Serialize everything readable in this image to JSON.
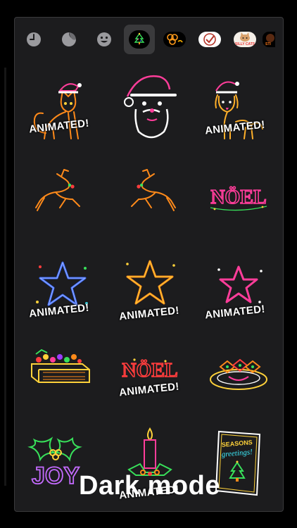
{
  "tabs": [
    {
      "name": "recents",
      "icon": "clock-icon"
    },
    {
      "name": "stickers-peel",
      "icon": "peel-sticker-icon"
    },
    {
      "name": "emoji",
      "icon": "smiley-icon"
    },
    {
      "name": "christmas-neon",
      "icon": "christmas-tree-icon",
      "active": true
    },
    {
      "name": "honeycomb-pack",
      "icon": "honeycomb-icon"
    },
    {
      "name": "checkmark-pack",
      "icon": "checkmark-icon"
    },
    {
      "name": "silly-cats-pack",
      "icon": "cat-icon",
      "text": "SILLY CATS"
    },
    {
      "name": "partial-pack",
      "icon": "sticker-pack-icon"
    }
  ],
  "stickers": {
    "cat_badge": "ANIMATED!",
    "dog_badge": "ANIMATED!",
    "noel_text": "NÖEL",
    "blue_star_badge": "ANIMATED!",
    "orange_star_badge": "ANIMATED!",
    "pink_star_badge": "ANIMATED!",
    "noel2_text": "NÖEL",
    "noel2_badge": "ANIMATED!",
    "joy_text": "JOY",
    "candle_badge": "ANIMATED!",
    "card_text_1": "SEASONS",
    "card_text_2": "greetings!"
  },
  "caption": "Dark mode",
  "colors": {
    "panel": "#1c1c1e",
    "neon_orange": "#ff8a1a",
    "neon_pink": "#ff3d9a",
    "neon_blue": "#3d6bff",
    "neon_green": "#38e05a",
    "neon_yellow": "#ffd23a",
    "white": "#ffffff"
  }
}
